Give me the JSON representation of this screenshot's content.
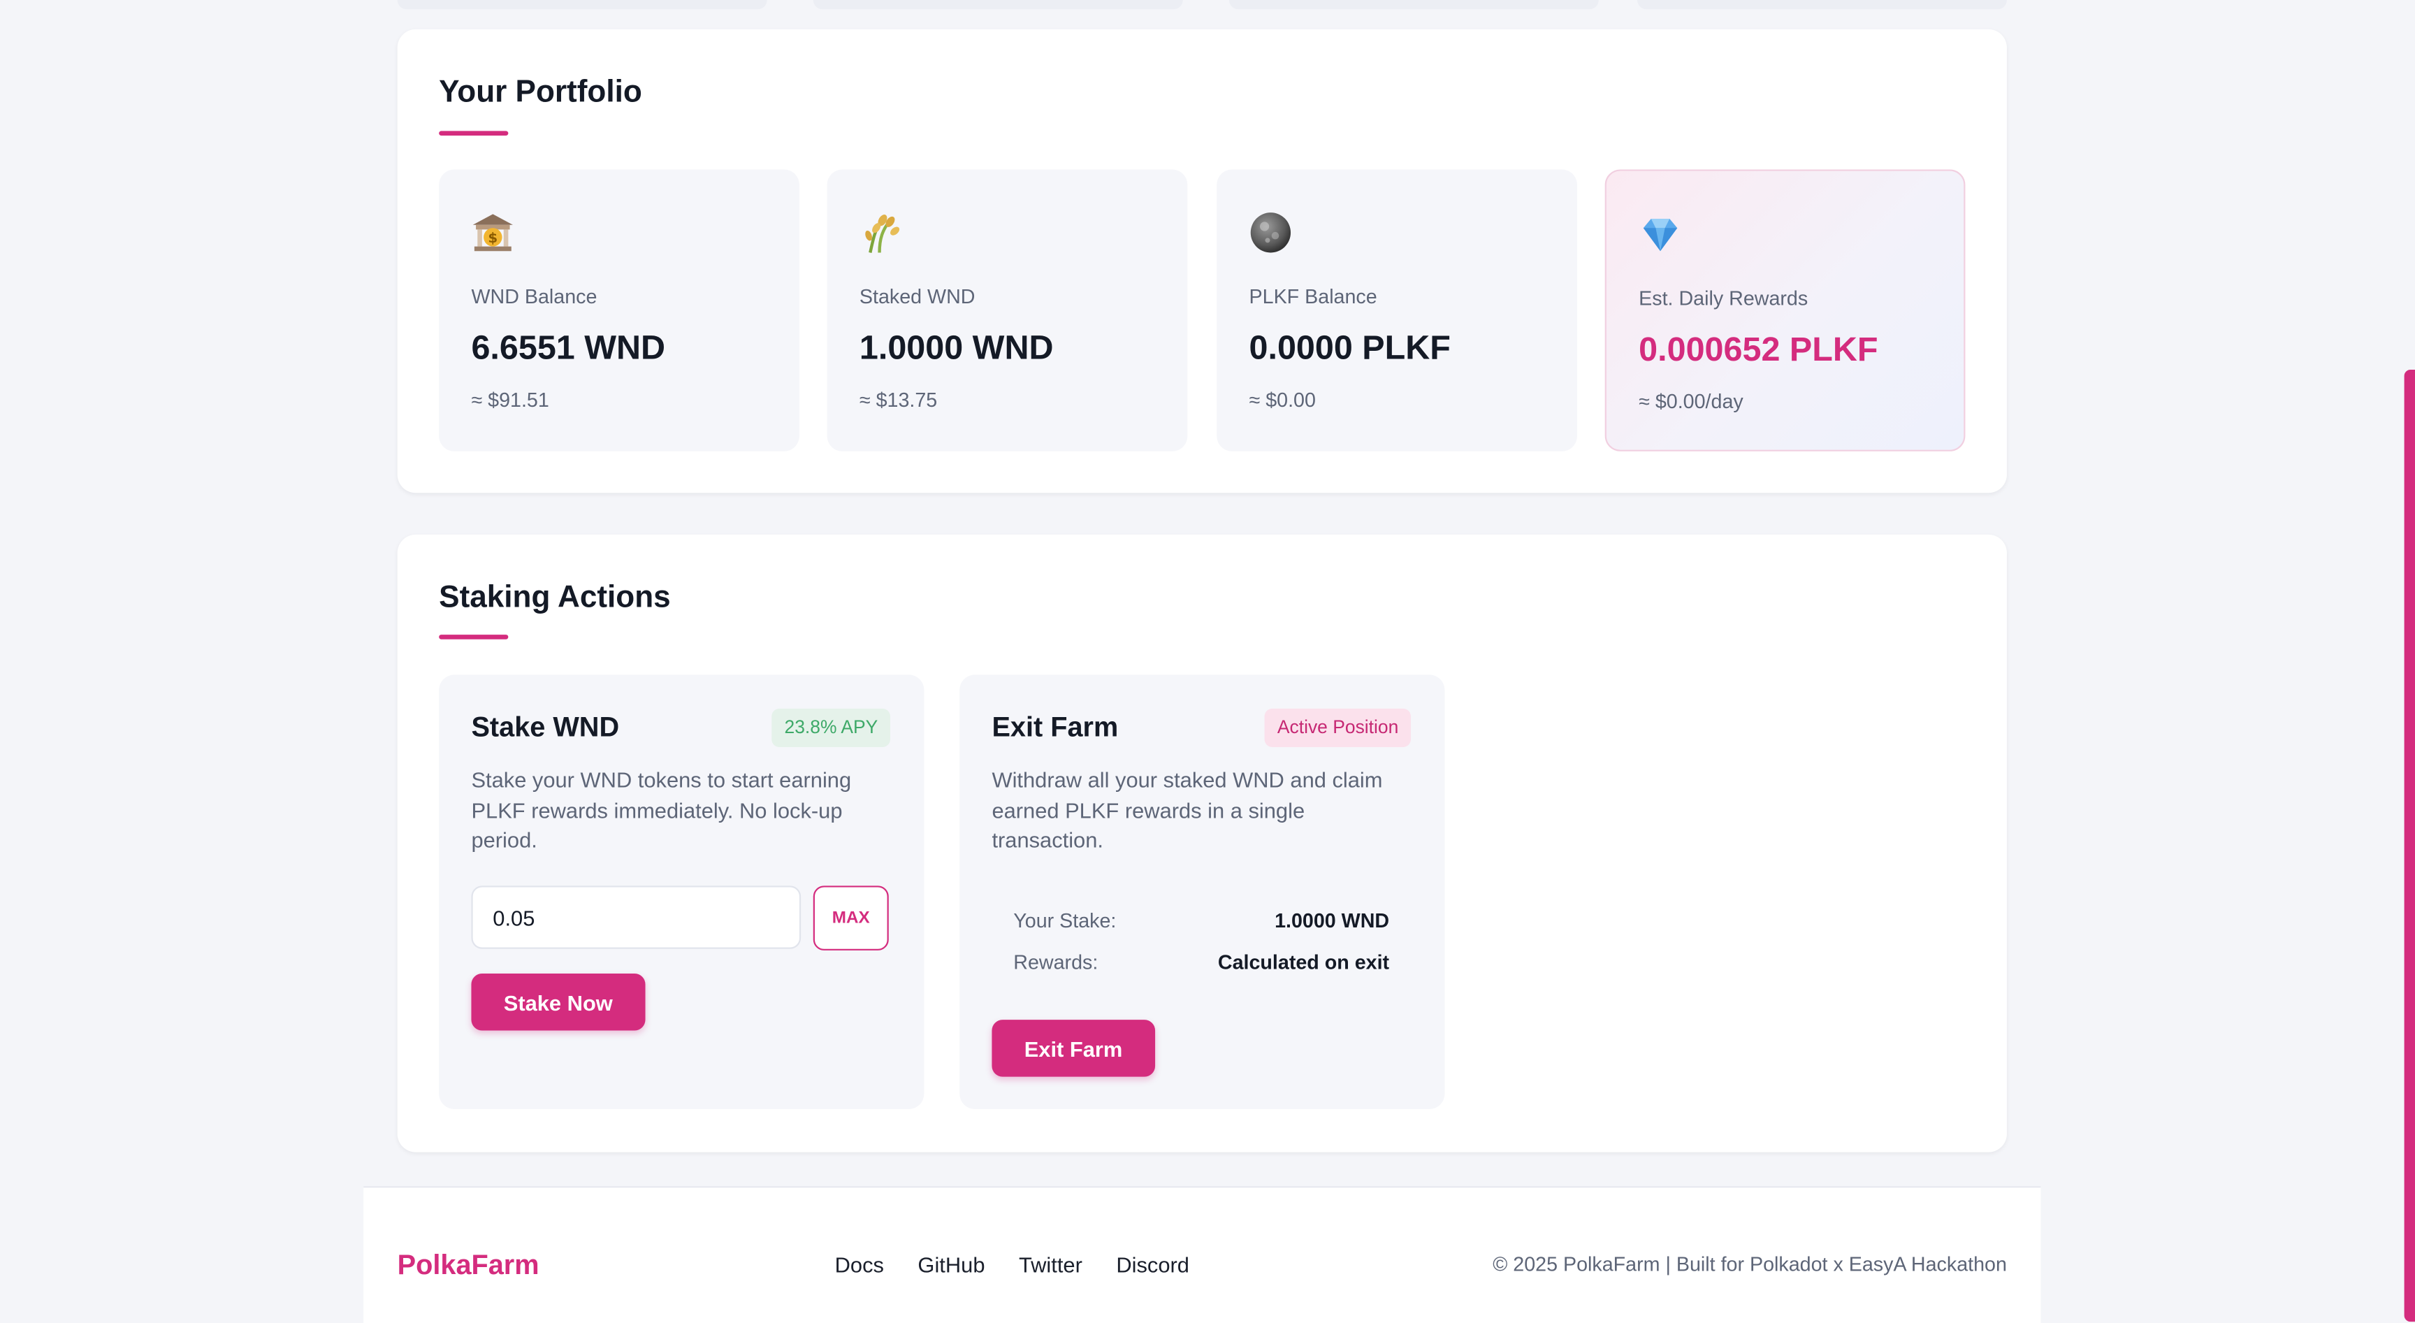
{
  "colors": {
    "accent": "#d42c7e",
    "success": "#3ea968",
    "muted": "#5d6577",
    "background": "#f4f5f9"
  },
  "portfolio": {
    "title": "Your Portfolio",
    "stats": [
      {
        "icon": "bank-icon",
        "label": "WND Balance",
        "value": "6.6551 WND",
        "sub": "≈ $91.51"
      },
      {
        "icon": "rice-sheaf-icon",
        "label": "Staked WND",
        "value": "1.0000 WND",
        "sub": "≈ $13.75"
      },
      {
        "icon": "moon-icon",
        "label": "PLKF Balance",
        "value": "0.0000 PLKF",
        "sub": "≈ $0.00"
      },
      {
        "icon": "gem-icon",
        "label": "Est. Daily Rewards",
        "value": "0.000652 PLKF",
        "sub": "≈ $0.00/day"
      }
    ]
  },
  "staking": {
    "title": "Staking Actions",
    "stake": {
      "title": "Stake WND",
      "badge": "23.8% APY",
      "description": "Stake your WND tokens to start earning PLKF rewards immediately. No lock-up period.",
      "amount_value": "0.05",
      "max_label": "MAX",
      "button_label": "Stake Now"
    },
    "exit": {
      "title": "Exit Farm",
      "badge": "Active Position",
      "description": "Withdraw all your staked WND and claim earned PLKF rewards in a single transaction.",
      "stake_label": "Your Stake:",
      "stake_value": "1.0000 WND",
      "rewards_label": "Rewards:",
      "rewards_value": "Calculated on exit",
      "button_label": "Exit Farm"
    }
  },
  "footer": {
    "brand": "PolkaFarm",
    "links": [
      "Docs",
      "GitHub",
      "Twitter",
      "Discord"
    ],
    "copyright": "© 2025 PolkaFarm | Built for Polkadot x EasyA Hackathon"
  }
}
